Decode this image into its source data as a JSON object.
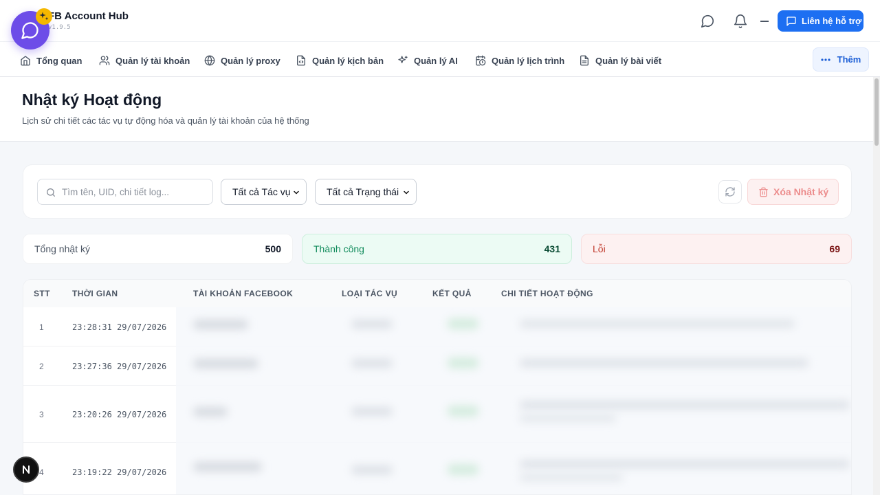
{
  "app": {
    "title": "FB Account Hub",
    "version": "v1.9.5"
  },
  "header": {
    "support_label": "Liên hệ hỗ trợ"
  },
  "nav": {
    "items": [
      {
        "label": "Tổng quan",
        "icon": "home-icon"
      },
      {
        "label": "Quản lý tài khoản",
        "icon": "users-icon"
      },
      {
        "label": "Quản lý proxy",
        "icon": "globe-icon"
      },
      {
        "label": "Quản lý kịch bản",
        "icon": "script-file-icon"
      },
      {
        "label": "Quản lý AI",
        "icon": "sparkles-icon"
      },
      {
        "label": "Quản lý lịch trình",
        "icon": "calendar-clock-icon"
      },
      {
        "label": "Quản lý bài viết",
        "icon": "document-icon"
      }
    ],
    "more_label": "Thêm"
  },
  "page": {
    "title": "Nhật ký Hoạt động",
    "subtitle": "Lịch sử chi tiết các tác vụ tự động hóa và quản lý tài khoản của hệ thống"
  },
  "filters": {
    "search_placeholder": "Tìm tên, UID, chi tiết log...",
    "task_select": "Tất cả Tác vụ",
    "status_select": "Tất cả Trạng thái",
    "delete_label": "Xóa Nhật ký"
  },
  "stats": {
    "total": {
      "label": "Tổng nhật ký",
      "value": "500"
    },
    "success": {
      "label": "Thành công",
      "value": "431"
    },
    "error": {
      "label": "Lỗi",
      "value": "69"
    }
  },
  "table": {
    "columns": [
      "STT",
      "THỜI GIAN",
      "TÀI KHOẢN FACEBOOK",
      "LOẠI TÁC VỤ",
      "KẾT QUẢ",
      "CHI TIẾT HOẠT ĐỘNG"
    ],
    "rows": [
      {
        "index": "1",
        "time": "23:28:31 29/07/2026"
      },
      {
        "index": "2",
        "time": "23:27:36 29/07/2026"
      },
      {
        "index": "3",
        "time": "23:20:26 29/07/2026"
      },
      {
        "index": "4",
        "time": "23:19:22 29/07/2026"
      }
    ]
  },
  "colors": {
    "primary": "#1d6ff2",
    "bubble": "#6d4de8",
    "success": "#0f8a5a",
    "error": "#c0392b"
  }
}
